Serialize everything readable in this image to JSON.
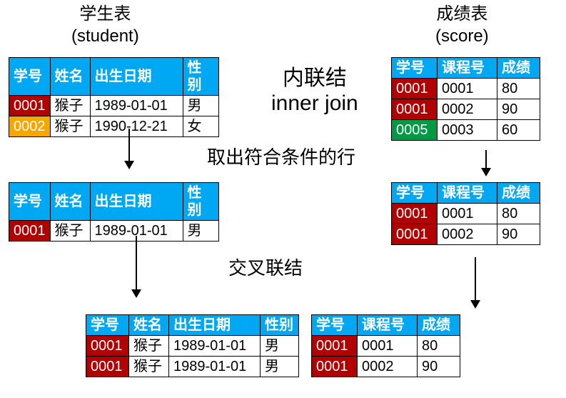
{
  "titles": {
    "student_cn": "学生表",
    "student_en": "(student)",
    "score_cn": "成绩表",
    "score_en": "(score)"
  },
  "labels": {
    "join_cn": "内联结",
    "join_en": "inner join",
    "filter": "取出符合条件的行",
    "cross": "交叉联结"
  },
  "student_headers": [
    "学号",
    "姓名",
    "出生日期",
    "性别"
  ],
  "score_headers": [
    "学号",
    "课程号",
    "成绩"
  ],
  "student_top": [
    {
      "id": "0001",
      "name": "猴子",
      "dob": "1989-01-01",
      "sex": "男",
      "cls": "id-red"
    },
    {
      "id": "0002",
      "name": "猴子",
      "dob": "1990-12-21",
      "sex": "女",
      "cls": "id-orange"
    }
  ],
  "score_top": [
    {
      "id": "0001",
      "course": "0001",
      "grade": "80",
      "cls": "id-red"
    },
    {
      "id": "0001",
      "course": "0002",
      "grade": "90",
      "cls": "id-red"
    },
    {
      "id": "0005",
      "course": "0003",
      "grade": "60",
      "cls": "id-green"
    }
  ],
  "student_mid": [
    {
      "id": "0001",
      "name": "猴子",
      "dob": "1989-01-01",
      "sex": "男",
      "cls": "id-red"
    }
  ],
  "score_mid": [
    {
      "id": "0001",
      "course": "0001",
      "grade": "80",
      "cls": "id-red"
    },
    {
      "id": "0001",
      "course": "0002",
      "grade": "90",
      "cls": "id-red"
    }
  ],
  "student_bottom": [
    {
      "id": "0001",
      "name": "猴子",
      "dob": "1989-01-01",
      "sex": "男",
      "cls": "id-red"
    },
    {
      "id": "0001",
      "name": "猴子",
      "dob": "1989-01-01",
      "sex": "男",
      "cls": "id-red"
    }
  ],
  "score_bottom": [
    {
      "id": "0001",
      "course": "0001",
      "grade": "80",
      "cls": "id-red"
    },
    {
      "id": "0001",
      "course": "0002",
      "grade": "90",
      "cls": "id-red"
    }
  ]
}
